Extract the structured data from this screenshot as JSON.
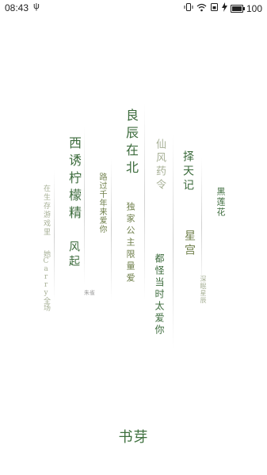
{
  "status_bar": {
    "time": "08:43",
    "usb_symbol": "ψ",
    "battery_percent": "100",
    "battery_level": 1.0
  },
  "columns": [
    {
      "id": "c1",
      "text": "在生存游戏里"
    },
    {
      "id": "c2",
      "text": "她Carry全场"
    },
    {
      "id": "c3",
      "text": "西诱柠檬精"
    },
    {
      "id": "c4",
      "text": "风起"
    },
    {
      "id": "c5",
      "text": "路过千年来爱你"
    },
    {
      "id": "c6",
      "text": "朱雀"
    },
    {
      "id": "c7",
      "text": "良辰在北"
    },
    {
      "id": "c8",
      "text": "独家公主限量爱"
    },
    {
      "id": "c9",
      "text": "仙风药令"
    },
    {
      "id": "c10",
      "text": "都怪当时太爱你"
    },
    {
      "id": "c11",
      "text": "择天记"
    },
    {
      "id": "c12",
      "text": "星宫"
    },
    {
      "id": "c13",
      "text": "黑莲花"
    },
    {
      "id": "c14",
      "text": "深眠星辰"
    }
  ],
  "brand": {
    "name": "书芽"
  },
  "colors": {
    "accent": "#3d6f3d",
    "background": "#ffffff"
  }
}
